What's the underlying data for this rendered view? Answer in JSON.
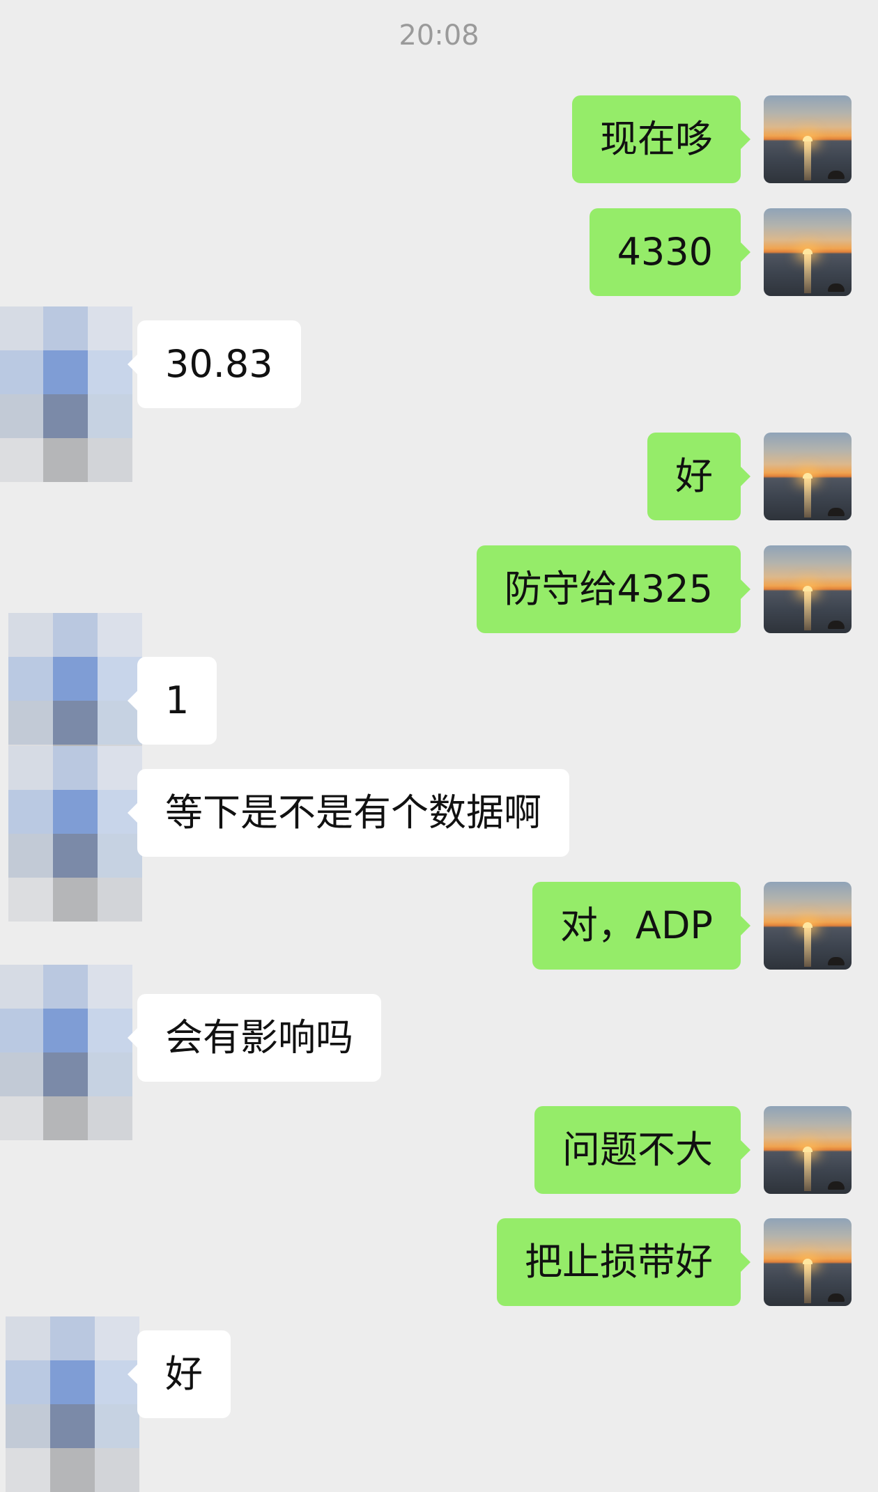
{
  "timestamp": "20:08",
  "colors": {
    "background": "#ededed",
    "outgoing_bubble": "#95ec69",
    "incoming_bubble": "#ffffff",
    "timestamp_text": "#9a9a9a",
    "message_text": "#111111"
  },
  "self_avatar": {
    "icon": "sunset-over-sea-photo"
  },
  "contact_avatar": {
    "icon": "pixelated-avatar",
    "palette": [
      [
        "#d6dbe4",
        "#bac8e0",
        "#dbe0ea"
      ],
      [
        "#bac9e2",
        "#7f9dd5",
        "#c8d5ea"
      ],
      [
        "#c2cad6",
        "#7b8aa8",
        "#c6d2e2"
      ],
      [
        "#dcdde0",
        "#b5b6b8",
        "#d2d4d8"
      ]
    ]
  },
  "messages": [
    {
      "side": "out",
      "text": "现在哆"
    },
    {
      "side": "out",
      "text": "4330"
    },
    {
      "side": "in",
      "text": "30.83"
    },
    {
      "side": "out",
      "text": "好"
    },
    {
      "side": "out",
      "text": "防守给4325"
    },
    {
      "side": "in",
      "text": "1"
    },
    {
      "side": "in",
      "text": "等下是不是有个数据啊"
    },
    {
      "side": "out",
      "text": "对，ADP"
    },
    {
      "side": "in",
      "text": "会有影响吗"
    },
    {
      "side": "out",
      "text": "问题不大"
    },
    {
      "side": "out",
      "text": "把止损带好"
    },
    {
      "side": "in",
      "text": "好"
    }
  ]
}
